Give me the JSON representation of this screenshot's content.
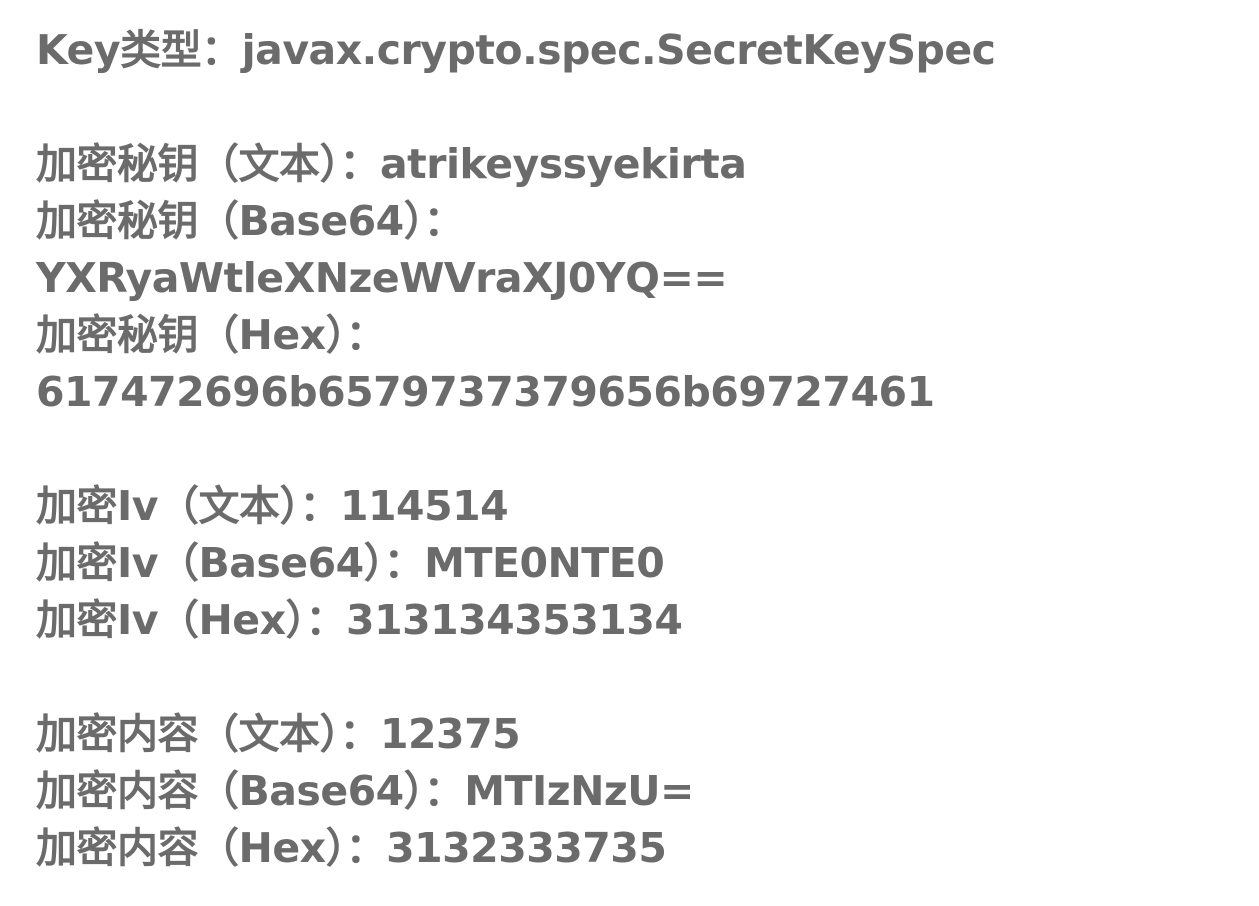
{
  "key_type": {
    "label": "Key类型：",
    "value": "javax.crypto.spec.SecretKeySpec"
  },
  "key": {
    "text_label": "加密秘钥（文本）：",
    "text_value": "atrikeyssyekirta",
    "base64_label": "加密秘钥（Base64）：",
    "base64_value": "YXRyaWtleXNzeWVraXJ0YQ==",
    "hex_label": "加密秘钥（Hex）：",
    "hex_value": "617472696b6579737379656b69727461"
  },
  "iv": {
    "text_label": "加密Iv（文本）：",
    "text_value": "114514",
    "base64_label": "加密Iv（Base64）：",
    "base64_value": "MTE0NTE0",
    "hex_label": "加密Iv（Hex）：",
    "hex_value": "313134353134"
  },
  "content": {
    "text_label": "加密内容（文本）：",
    "text_value": "12375",
    "base64_label": "加密内容（Base64）：",
    "base64_value": "MTIzNzU=",
    "hex_label": "加密内容（Hex）：",
    "hex_value": "3132333735"
  }
}
